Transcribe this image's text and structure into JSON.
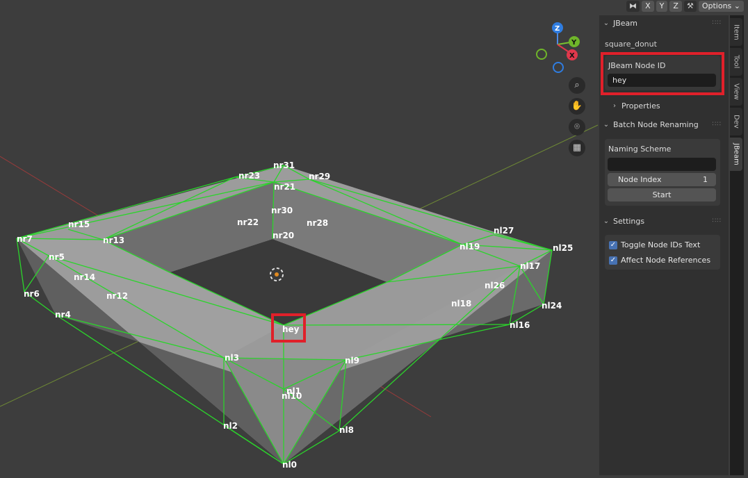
{
  "header": {
    "x_label": "X",
    "y_label": "Y",
    "z_label": "Z",
    "options_label": "Options"
  },
  "gizmo": {
    "x": "X",
    "y": "Y",
    "z": "Z"
  },
  "nav_icons": [
    "zoom-icon",
    "hand-icon",
    "camera-icon",
    "grid-icon"
  ],
  "panel": {
    "section1": {
      "title": "JBeam",
      "object_name": "square_donut",
      "node_id_label": "JBeam Node ID",
      "node_id_value": "hey",
      "properties_label": "Properties"
    },
    "section2": {
      "title": "Batch Node Renaming",
      "naming_scheme_label": "Naming Scheme",
      "naming_scheme_value": "",
      "node_index_label": "Node Index",
      "node_index_value": "1",
      "start_label": "Start"
    },
    "section3": {
      "title": "Settings",
      "toggle_ids_label": "Toggle Node IDs Text",
      "affect_refs_label": "Affect Node References"
    }
  },
  "tabs": [
    "Item",
    "Tool",
    "View",
    "Dev",
    "JBeam"
  ],
  "node_labels": {
    "nr31": "nr31",
    "nr23": "nr23",
    "nr29": "nr29",
    "nr21": "nr21",
    "nr30": "nr30",
    "nr15": "nr15",
    "nr22": "nr22",
    "nr28": "nr28",
    "nr7": "nr7",
    "nr13": "nr13",
    "nr20": "nr20",
    "nl27": "nl27",
    "nl19": "nl19",
    "nl25": "nl25",
    "nr5": "nr5",
    "nl17": "nl17",
    "nr14": "nr14",
    "nr6": "nr6",
    "nr12": "nr12",
    "nl26": "nl26",
    "nl18": "nl18",
    "nl24": "nl24",
    "nr4": "nr4",
    "hey": "hey",
    "nl16": "nl16",
    "nl3": "nl3",
    "nl9": "nl9",
    "nl1": "nl1",
    "nl10": "nl10",
    "nl2": "nl2",
    "nl8": "nl8",
    "nl0": "nl0"
  }
}
